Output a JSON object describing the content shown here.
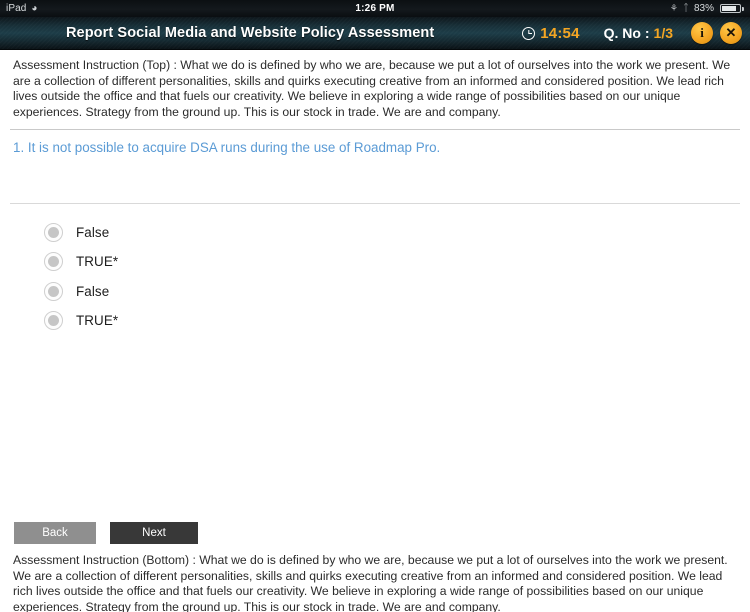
{
  "status_bar": {
    "device_label": "iPad",
    "wifi_icon": "wifi-icon",
    "time": "1:26 PM",
    "rotation_lock_icon": "rotation-lock-icon",
    "bluetooth_icon": "bluetooth-icon",
    "battery_percent": "83%",
    "battery_icon": "battery-icon"
  },
  "header": {
    "title": "Report Social Media and Website Policy Assessment",
    "clock_icon": "clock-icon",
    "timer": "14:54",
    "question_number_label": "Q. No :",
    "question_number_value": "1/3",
    "info_button": "i",
    "close_button": "✕",
    "accent_color": "#f5a623",
    "background_color": "#1d3d48"
  },
  "main": {
    "instruction_top": "Assessment Instruction (Top) : What we do is defined by who we are, because we put a lot of ourselves into the work we present. We are a collection of different personalities, skills and quirks executing creative from an informed and considered position. We lead rich lives outside the office and that fuels our creativity. We believe in exploring a wide range of possibilities based on our unique experiences. Strategy from the ground up. This is our stock in trade. We are and company.",
    "question_text": "1. It is not possible to acquire DSA runs during the use of Roadmap Pro.",
    "question_color": "#5b9bd5",
    "options": [
      {
        "label": "False",
        "selected": false
      },
      {
        "label": "TRUE*",
        "selected": false
      },
      {
        "label": "False",
        "selected": false
      },
      {
        "label": "TRUE*",
        "selected": false
      }
    ],
    "instruction_bottom": "Assessment Instruction (Bottom) : What we do is defined by who we are, because we put a lot of ourselves into the work we present. We are a collection of different personalities, skills and quirks executing creative from an informed and considered position. We lead rich lives outside the office and that fuels our creativity. We believe in exploring a wide range of possibilities based on our unique experiences. Strategy from the ground up. This is our stock in trade. We are and company."
  },
  "footer": {
    "back_label": "Back",
    "next_label": "Next"
  }
}
